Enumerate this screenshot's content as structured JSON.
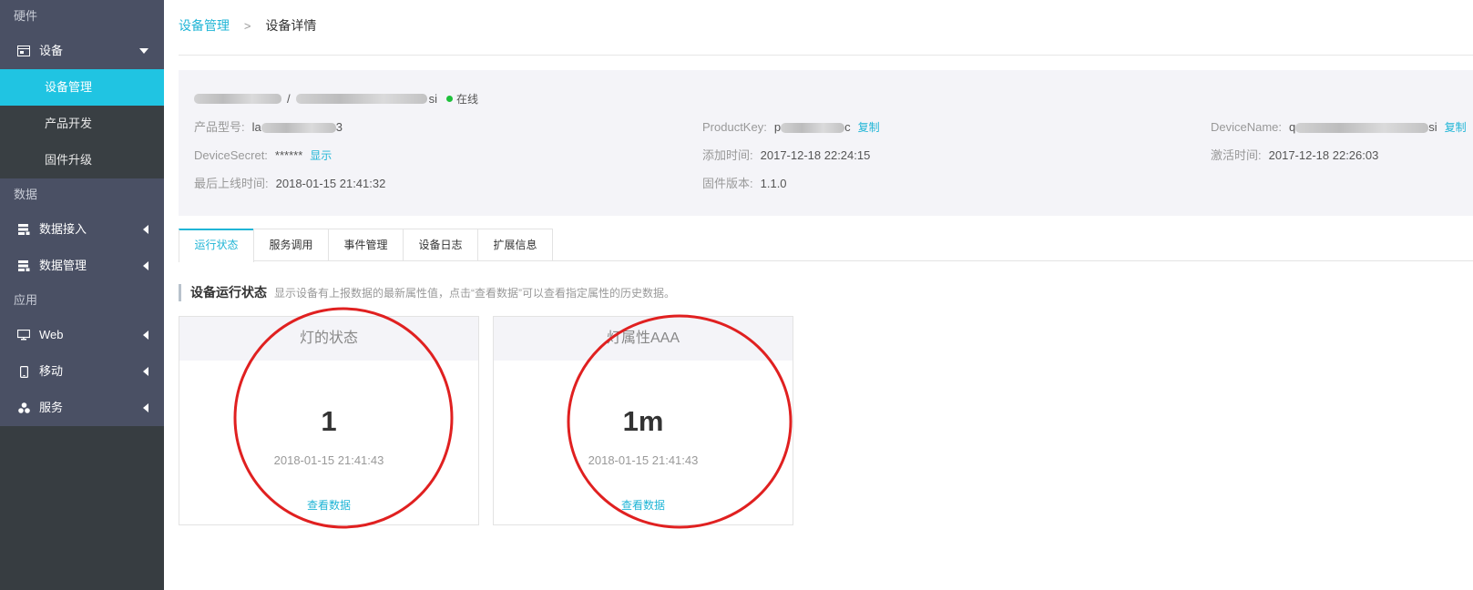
{
  "sidebar": {
    "section_hardware": "硬件",
    "device_label": "设备",
    "device_subs": [
      "设备管理",
      "产品开发",
      "固件升级"
    ],
    "section_data": "数据",
    "data_items": [
      "数据接入",
      "数据管理"
    ],
    "section_app": "应用",
    "app_items": [
      "Web",
      "移动",
      "服务"
    ]
  },
  "breadcrumb": {
    "parent": "设备管理",
    "separator": ">",
    "current": "设备详情"
  },
  "device": {
    "name_sep": "/",
    "status": "在线",
    "product_model_label": "产品型号:",
    "product_model_value_visible": "la",
    "product_model_value_tail": "3",
    "product_key_label": "ProductKey:",
    "product_key_value_head": "p",
    "product_key_value_tail": "c",
    "copy_label": "复制",
    "device_name_label": "DeviceName:",
    "device_name_value_head": "q",
    "device_name_value_tail": "si",
    "name_tail": "si",
    "device_secret_label": "DeviceSecret:",
    "device_secret_value": "******",
    "show_label": "显示",
    "added_time_label": "添加时间:",
    "added_time_value": "2017-12-18 22:24:15",
    "activated_time_label": "激活时间:",
    "activated_time_value": "2017-12-18 22:26:03",
    "last_online_label": "最后上线时间:",
    "last_online_value": "2018-01-15 21:41:32",
    "firmware_label": "固件版本:",
    "firmware_value": "1.1.0"
  },
  "tabs": [
    "运行状态",
    "服务调用",
    "事件管理",
    "设备日志",
    "扩展信息"
  ],
  "active_tab": "运行状态",
  "section": {
    "title": "设备运行状态",
    "desc": "显示设备有上报数据的最新属性值，点击“查看数据”可以查看指定属性的历史数据。"
  },
  "cards": [
    {
      "title": "灯的状态",
      "value": "1",
      "time": "2018-01-15 21:41:43",
      "link": "查看数据"
    },
    {
      "title": "灯属性AAA",
      "value": "1m",
      "time": "2018-01-15 21:41:43",
      "link": "查看数据"
    }
  ],
  "colors": {
    "accent": "#20c4e2",
    "link": "#20b5d6",
    "online": "#1ec13b",
    "annotation": "#e02020",
    "sidebar": "#4a5064"
  },
  "icons": [
    "window-icon",
    "caret-down-icon",
    "database-icon",
    "caret-left-icon",
    "monitor-icon",
    "mobile-icon",
    "cluster-icon",
    "breadcrumb-chevron-icon",
    "status-dot-icon"
  ]
}
